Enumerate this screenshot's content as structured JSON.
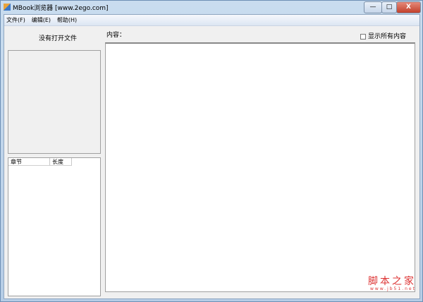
{
  "window": {
    "title": "MBook浏览器 [www.2ego.com]",
    "minimize": "—",
    "maximize": "□",
    "close": "X"
  },
  "menu": [
    "文件(F)",
    "编辑(E)",
    "帮助(H)"
  ],
  "left": {
    "status": "没有打开文件",
    "columns": [
      "章节",
      "长度"
    ]
  },
  "content": {
    "label": "内容：",
    "show_all": "显示所有内容"
  },
  "watermark": {
    "cn": "脚本之家",
    "url": "www.jb51.net"
  }
}
